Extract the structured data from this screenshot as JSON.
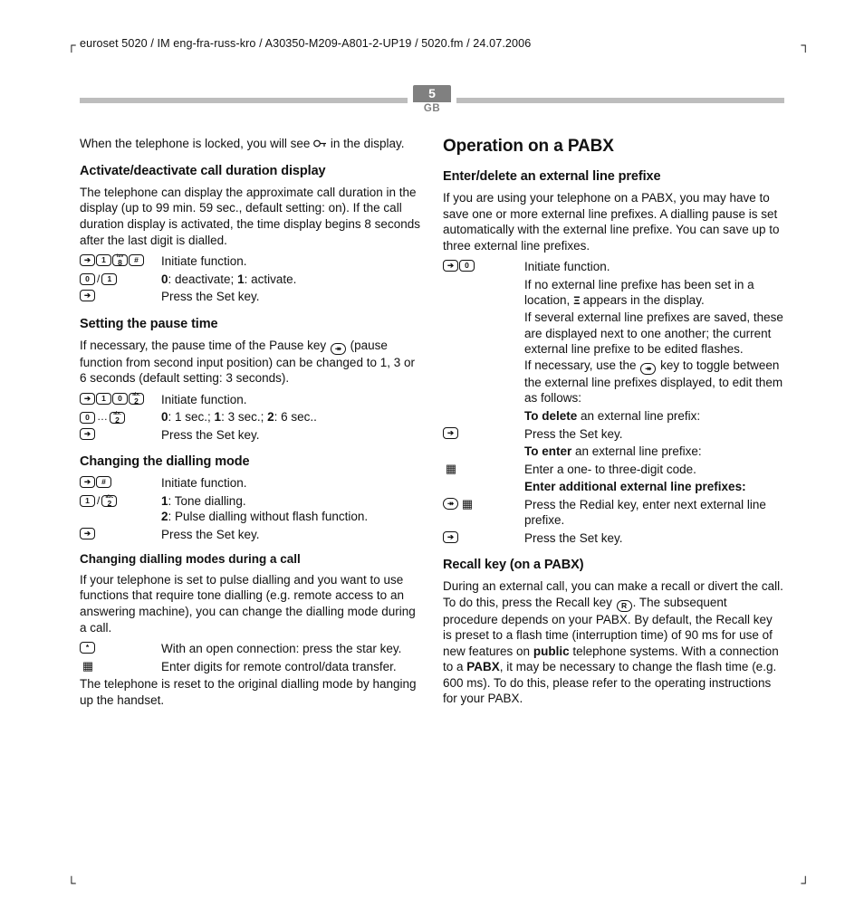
{
  "header": {
    "line": "euroset 5020 / IM eng-fra-russ-kro / A30350-M209-A801-2-UP19 / 5020.fm / 24.07.2006",
    "page_number": "5",
    "region": "GB"
  },
  "left": {
    "intro_a": "When the telephone is locked, you will see ",
    "intro_b": " in the display.",
    "s1": {
      "title": "Activate/deactivate call duration display",
      "para": "The telephone can display the approximate call duration in the display (up to 99 min. 59 sec., default setting: on). If the call duration display is activated, the time display begins 8 seconds after the last digit is dialled.",
      "r1": "Initiate function.",
      "r2a": "0",
      "r2b": ": deactivate;   ",
      "r2c": "1",
      "r2d": ": activate.",
      "r3": "Press the Set key."
    },
    "s2": {
      "title": "Setting the pause time",
      "para_a": "If necessary, the pause time of the Pause key ",
      "para_b": " (pause function from second input position) can be changed to 1, 3 or 6 seconds (default setting: 3 seconds).",
      "r1": "Initiate function.",
      "r2a": "0",
      "r2b": ": 1 sec.;   ",
      "r2c": "1",
      "r2d": ": 3 sec.;   ",
      "r2e": "2",
      "r2f": ": 6 sec..",
      "r3": "Press the Set key."
    },
    "s3": {
      "title": "Changing the dialling mode",
      "r1": "Initiate function.",
      "r2a": "1",
      "r2b": ": Tone dialling.",
      "r2c": "2",
      "r2d": ": Pulse dialling without flash function.",
      "r3": "Press the Set key."
    },
    "s4": {
      "title": "Changing dialling modes during a call",
      "para": "If your telephone is set to pulse dialling and you want to use functions that require tone dialling (e.g. remote access to an answering machine), you can change the dialling mode during a call.",
      "r1": "With an open connection: press the star key.",
      "r2": "Enter digits for remote control/data transfer.",
      "outro": "The telephone is reset to the original dialling mode by hanging up the handset."
    }
  },
  "right": {
    "title": "Operation on a PABX",
    "s1": {
      "title": "Enter/delete an external line prefixe",
      "para": "If you are using your telephone on a PABX, you may have to save one or more external line prefixes. A dialling pause is set automatically with the external line prefixe. You can save up to three external line prefixes.",
      "r1": "Initiate function.",
      "r2a": "If no external line prefixe has been set in a location,   ",
      "r2b": "  appears in the display.",
      "r2c": "If several external line prefixes are saved, these are displayed next to one another; the current external line prefixe to be edited flashes.",
      "r2d": "If necessary, use the ",
      "r2e": " key to toggle between the external line prefixes displayed, to edit them as follows:",
      "r3a": "To delete",
      "r3b": " an external line prefix:",
      "r4": "Press the Set key.",
      "r5a": "To enter",
      "r5b": " an external line prefixe:",
      "r6": "Enter a one- to three-digit code.",
      "r7": "Enter additional external line prefixes:",
      "r8": "Press the Redial key, enter next external line prefixe.",
      "r9": "Press the Set key."
    },
    "s2": {
      "title": "Recall key (on a PABX)",
      "p1a": "During an external call, you can make a recall or divert the call. To do this, press the Recall key ",
      "p1b": ". The subsequent procedure depends on your PABX. By default, the Recall key is preset to a flash time (interruption time) of 90 ms for use of new features on ",
      "p1c": "public",
      "p1d": " telephone systems. With a connection to a ",
      "p1e": "PABX",
      "p1f": ", it may be necessary to change the flash time (e.g. 600 ms). To do this, please refer to the operating instructions for your PABX."
    }
  }
}
